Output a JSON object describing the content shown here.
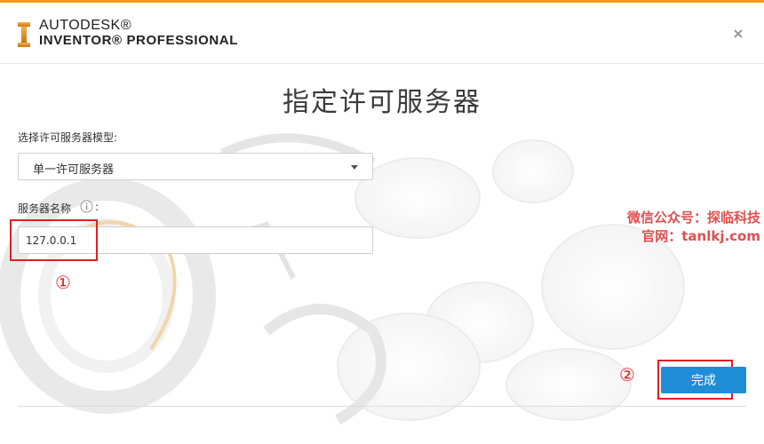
{
  "header": {
    "brand_line1": "AUTODESK®",
    "brand_line2": "INVENTOR® PROFESSIONAL",
    "accent_color": "#f39c1e",
    "logo_icon": "inventor-logo-icon",
    "close_icon": "close-icon"
  },
  "main": {
    "title": "指定许可服务器",
    "server_model_label": "选择许可服务器模型:",
    "server_model_value": "单一许可服务器",
    "server_name_label": "服务器名称",
    "server_name_colon": ":",
    "server_name_value": "127.0.0.1"
  },
  "annotations": {
    "marker_1": "①",
    "marker_2": "②",
    "highlight_color": "#e02020"
  },
  "watermark": {
    "line1": "微信公众号：探临科技",
    "line2": "官网：tanlkj.com"
  },
  "footer": {
    "done_label": "完成",
    "button_color": "#1f8ed6"
  }
}
